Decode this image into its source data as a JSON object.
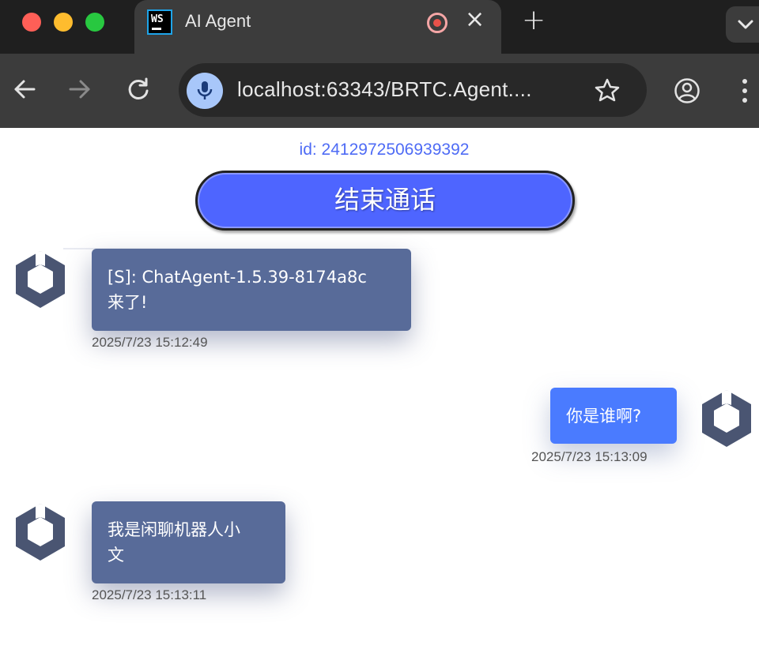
{
  "browser": {
    "tab": {
      "favicon_text": "WS",
      "title": "AI Agent"
    },
    "new_tab_label": "+",
    "close_label": "×",
    "url": "localhost:63343/BRTC.Agent...."
  },
  "page": {
    "session_id": "id: 2412972506939392",
    "end_call_label": "结束通话"
  },
  "messages": [
    {
      "role": "agent",
      "lines": [
        "[S]: ChatAgent-1.5.39-8174a8c",
        "来了!"
      ],
      "time": "2025/7/23 15:12:49"
    },
    {
      "role": "user",
      "lines": [
        "你是谁啊?"
      ],
      "time": "2025/7/23 15:13:09"
    },
    {
      "role": "agent",
      "lines": [
        "我是闲聊机器人小",
        "文"
      ],
      "time": "2025/7/23 15:13:11"
    }
  ],
  "colors": {
    "accent": "#4e65ff",
    "agent_bubble": "#586b99",
    "user_bubble": "#4a7bff",
    "id_text": "#4e6bf5"
  }
}
